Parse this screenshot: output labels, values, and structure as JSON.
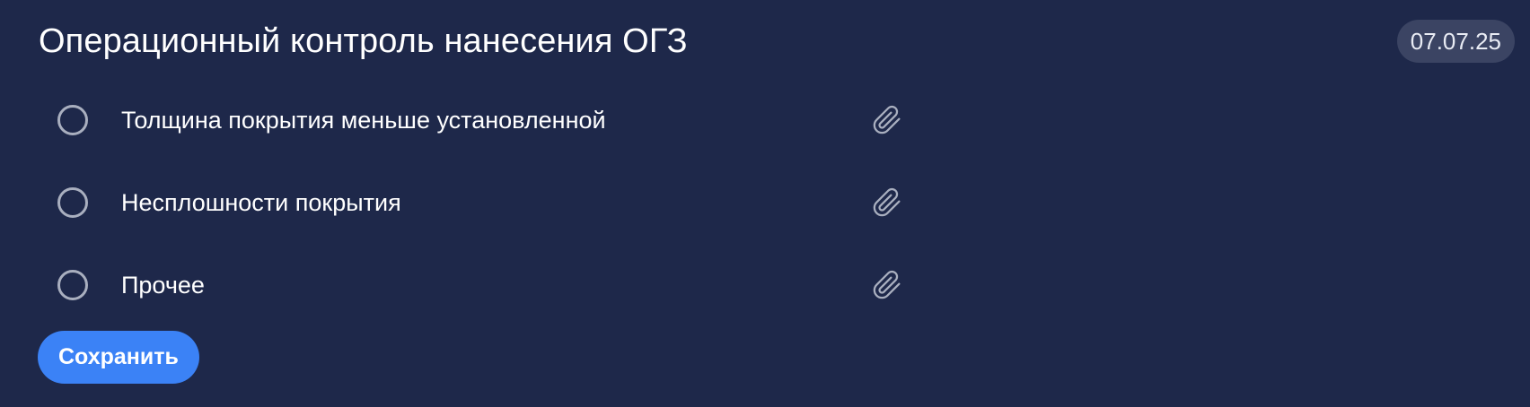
{
  "header": {
    "title": "Операционный контроль нанесения ОГЗ",
    "date": "07.07.25"
  },
  "options": [
    {
      "label": "Толщина покрытия меньше установленной",
      "attach_icon": "paperclip-icon"
    },
    {
      "label": "Несплошности покрытия",
      "attach_icon": "paperclip-icon"
    },
    {
      "label": "Прочее",
      "attach_icon": "paperclip-icon"
    }
  ],
  "actions": {
    "save_label": "Сохранить"
  },
  "colors": {
    "background": "#1e284a",
    "date_badge": "#3b4463",
    "accent": "#3b82f6",
    "radio_border": "#a9afbf",
    "icon": "#a9afbf"
  }
}
